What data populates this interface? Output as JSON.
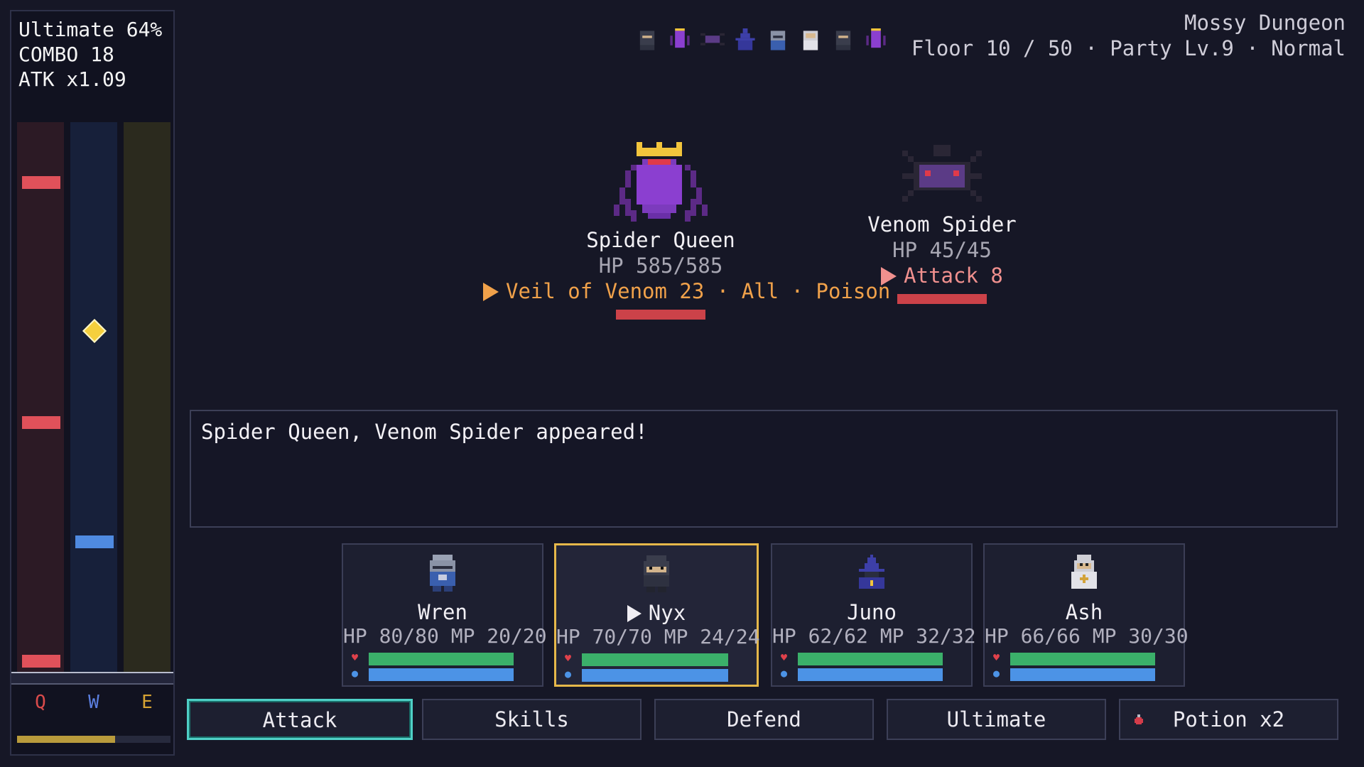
{
  "hud": {
    "ultimate": "Ultimate 64%",
    "combo": "COMBO 18",
    "atk": "ATK x1.09",
    "ultimate_charge": 0.64,
    "lanes": [
      {
        "key": "Q",
        "color": "#d94b4b"
      },
      {
        "key": "W",
        "color": "#5b7fe0"
      },
      {
        "key": "E",
        "color": "#d6a233"
      }
    ]
  },
  "header": {
    "dungeon": "Mossy Dungeon",
    "status": "Floor 10 / 50 · Party Lv.9 · Normal",
    "turn_order": [
      "ninja-icon",
      "spider-queen-icon",
      "venom-spider-icon",
      "wizard-icon",
      "knight-icon",
      "cleric-icon",
      "ninja-icon",
      "spider-queen-icon"
    ]
  },
  "enemies": [
    {
      "name": "Spider Queen",
      "hp": "HP 585/585",
      "intent": "Veil of Venom 23 · All · Poison",
      "hp_fraction": 1.0
    },
    {
      "name": "Venom Spider",
      "hp": "HP 45/45",
      "intent": "Attack 8",
      "hp_fraction": 1.0
    }
  ],
  "log": {
    "message": "Spider Queen, Venom Spider appeared!"
  },
  "party": [
    {
      "name": "Wren",
      "stats": "HP 80/80  MP 20/20",
      "hp_fraction": 1.0,
      "mp_fraction": 1.0,
      "icon": "knight-portrait"
    },
    {
      "name": "Nyx",
      "stats": "HP 70/70  MP 24/24",
      "hp_fraction": 1.0,
      "mp_fraction": 1.0,
      "icon": "ninja-portrait",
      "active": true
    },
    {
      "name": "Juno",
      "stats": "HP 62/62  MP 32/32",
      "hp_fraction": 1.0,
      "mp_fraction": 1.0,
      "icon": "wizard-portrait"
    },
    {
      "name": "Ash",
      "stats": "HP 66/66  MP 30/30",
      "hp_fraction": 1.0,
      "mp_fraction": 1.0,
      "icon": "cleric-portrait"
    }
  ],
  "actions": {
    "attack": "Attack",
    "skills": "Skills",
    "defend": "Defend",
    "ultimate": "Ultimate",
    "potion": "Potion x2"
  },
  "colors": {
    "accent_selected": "#4fd0c6",
    "active_member": "#e6b84a",
    "hp": "#3bb06a",
    "mp": "#4c93e6",
    "enemy_hp": "#cc4249"
  }
}
